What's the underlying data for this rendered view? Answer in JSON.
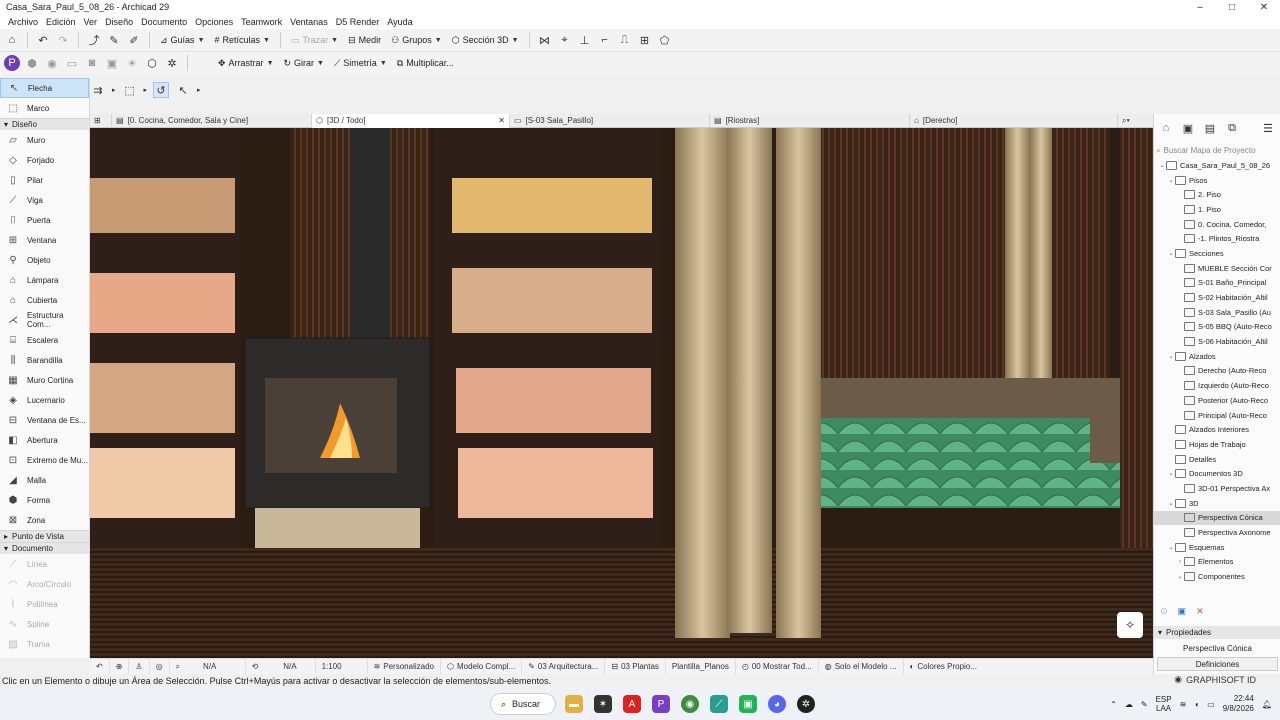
{
  "window": {
    "title": "Casa_Sara_Paul_5_08_26 - Archicad 29",
    "minimize": "–",
    "maximize": "□",
    "close": "✕"
  },
  "menu": [
    "Archivo",
    "Edición",
    "Ver",
    "Diseño",
    "Documento",
    "Opciones",
    "Teamwork",
    "Ventanas",
    "D5 Render",
    "Ayuda"
  ],
  "toolbar1": {
    "guias": "Guías",
    "reticulas": "Retículas",
    "trazar": "Trazar",
    "medir": "Medir",
    "grupos": "Grupos",
    "seccion3d": "Sección 3D"
  },
  "toolbar2": {
    "arrastrar": "Arrastrar",
    "girar": "Girar",
    "simetria": "Simetría",
    "multiplicar": "Multiplicar..."
  },
  "toolbox": {
    "select_tools": [
      "Flecha",
      "Marco"
    ],
    "design_head": "Diseño",
    "design_tools": [
      "Muro",
      "Forjado",
      "Pilar",
      "Viga",
      "Puerta",
      "Ventana",
      "Objeto",
      "Lámpara",
      "Cubierta",
      "Estructura Com...",
      "Escalera",
      "Barandilla",
      "Muro Cortina",
      "Lucernario",
      "Ventana de Es...",
      "Abertura",
      "Extremo de Mu...",
      "Malla",
      "Forma",
      "Zona"
    ],
    "viewpoint_head": "Punto de Vista",
    "document_head": "Documento",
    "document_tools": [
      "Línea",
      "Arco/Círculo",
      "Polilínea",
      "Spline",
      "Trama"
    ]
  },
  "tabs": [
    "[0. Cocina, Comedor, Sala y Cine]",
    "[3D / Todo]",
    "[S-03 Sala_Pasillo]",
    "[Riostras]",
    "[Derecho]"
  ],
  "navigator": {
    "search_placeholder": "Buscar Mapa de Proyecto",
    "tree": [
      {
        "label": "Casa_Sara_Paul_5_08_26",
        "level": 0,
        "toggle": "⌄"
      },
      {
        "label": "Pisos",
        "level": 1,
        "toggle": "⌄"
      },
      {
        "label": "2. Piso",
        "level": 2,
        "toggle": ""
      },
      {
        "label": "1. Piso",
        "level": 2,
        "toggle": ""
      },
      {
        "label": "0. Cocina, Comedor,",
        "level": 2,
        "toggle": ""
      },
      {
        "label": "-1. Plintos_Riostra",
        "level": 2,
        "toggle": ""
      },
      {
        "label": "Secciones",
        "level": 1,
        "toggle": "⌄"
      },
      {
        "label": "MUEBLE Sección Cor",
        "level": 2,
        "toggle": ""
      },
      {
        "label": "S-01 Baño_Principal",
        "level": 2,
        "toggle": ""
      },
      {
        "label": "S-02 Habitación_Altil",
        "level": 2,
        "toggle": ""
      },
      {
        "label": "S-03 Sala_Pasillo (Au",
        "level": 2,
        "toggle": ""
      },
      {
        "label": "S-05 BBQ (Auto-Reco",
        "level": 2,
        "toggle": ""
      },
      {
        "label": "S-06 Habitación_Altil",
        "level": 2,
        "toggle": ""
      },
      {
        "label": "Alzados",
        "level": 1,
        "toggle": "⌄"
      },
      {
        "label": "Derecho (Auto-Reco",
        "level": 2,
        "toggle": ""
      },
      {
        "label": "Izquierdo (Auto-Reco",
        "level": 2,
        "toggle": ""
      },
      {
        "label": "Posterior (Auto-Reco",
        "level": 2,
        "toggle": ""
      },
      {
        "label": "Principal (Auto-Reco",
        "level": 2,
        "toggle": ""
      },
      {
        "label": "Alzados Interiores",
        "level": 1,
        "toggle": ""
      },
      {
        "label": "Hojas de Trabajo",
        "level": 1,
        "toggle": ""
      },
      {
        "label": "Detalles",
        "level": 1,
        "toggle": ""
      },
      {
        "label": "Documentos 3D",
        "level": 1,
        "toggle": "⌄"
      },
      {
        "label": "3D-01 Perspectiva Ax",
        "level": 2,
        "toggle": ""
      },
      {
        "label": "3D",
        "level": 1,
        "toggle": "⌄"
      },
      {
        "label": "Perspectiva Cónica",
        "level": 2,
        "toggle": "",
        "selected": true
      },
      {
        "label": "Perspectiva Axonome",
        "level": 2,
        "toggle": ""
      },
      {
        "label": "Esquemas",
        "level": 1,
        "toggle": "⌄"
      },
      {
        "label": "Elementos",
        "level": 2,
        "toggle": "›"
      },
      {
        "label": "Componentes",
        "level": 2,
        "toggle": "⌄"
      }
    ],
    "props_head": "Propiedades",
    "props_value": "Perspectiva Cónica",
    "definitions": "Definiciones"
  },
  "viewport_status": [
    "N/A",
    "N/A",
    "1:100",
    "Personalizado",
    "Modelo Compl...",
    "03 Arquitectura...",
    "03 Plantas",
    "Plantilla_Planos",
    "00 Mostrar Tod...",
    "Solo el Modelo ...",
    "Colores Propio..."
  ],
  "statusbar": {
    "message": "Clic en un Elemento o dibuje un Área de Selección. Pulse Ctrl+Mayús para activar o desactivar la selección de elementos/sub-elementos.",
    "brand": "GRAPHISOFT ID"
  },
  "taskbar": {
    "search": "Buscar",
    "lang1": "ESP",
    "lang2": "LAA",
    "time": "22:44",
    "date": "9/8/2026"
  }
}
